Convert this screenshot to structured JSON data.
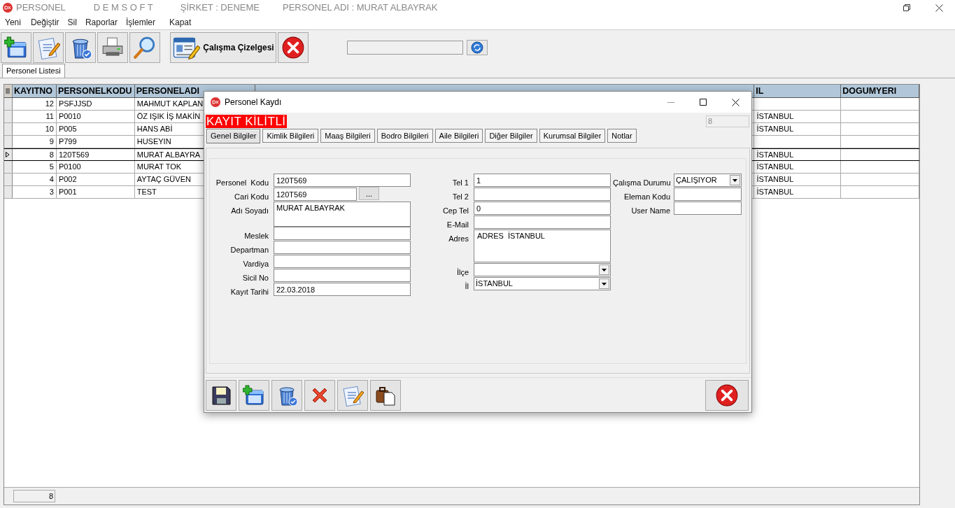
{
  "title_bar": {
    "app_name": "PERSONEL",
    "brand": "D E M S O F T",
    "company": "ŞİRKET : DENEME",
    "personnel": "PERSONEL ADI : MURAT ALBAYRAK"
  },
  "menu": [
    "Yeni",
    "Değiştir",
    "Sil",
    "Raporlar",
    "İşlemler",
    "Kapat"
  ],
  "toolbar": {
    "schedule_label": "Çalışma Çizelgesi"
  },
  "tabs": [
    {
      "label": "Personel Listesi",
      "selected": true
    }
  ],
  "grid": {
    "columns": [
      "KAYITNO",
      "PERSONELKODU",
      "PERSONELADI",
      "IL",
      "DOGUMYERI"
    ],
    "rows": [
      {
        "kayitno": "12",
        "personelkodu": "PSFJJSD",
        "personeladi": "MAHMUT KAPLAN",
        "selected": false
      },
      {
        "kayitno": "11",
        "personelkodu": "P0010",
        "personeladi": "ÖZ IŞIK İŞ MAKİN",
        "il": "İSTANBUL",
        "selected": false
      },
      {
        "kayitno": "10",
        "personelkodu": "P005",
        "personeladi": "HANS ABİ",
        "il": "İSTANBUL",
        "selected": false
      },
      {
        "kayitno": "9",
        "personelkodu": "P799",
        "personeladi": "HUSEYIN",
        "selected": false
      },
      {
        "kayitno": "8",
        "personelkodu": "120T569",
        "personeladi": "MURAT ALBAYRA",
        "il": "İSTANBUL",
        "selected": true
      },
      {
        "kayitno": "5",
        "personelkodu": "P0100",
        "personeladi": "MURAT TOK",
        "il": "İSTANBUL",
        "selected": false
      },
      {
        "kayitno": "4",
        "personelkodu": "P002",
        "personeladi": "AYTAÇ GÜVEN",
        "il": "İSTANBUL",
        "selected": false
      },
      {
        "kayitno": "3",
        "personelkodu": "P001",
        "personeladi": "TEST",
        "il": "İSTANBUL",
        "selected": false
      }
    ]
  },
  "status_bar": {
    "record_count": "8"
  },
  "dialog": {
    "title": "Personel Kaydı",
    "lock_banner": "KAYIT KİLİTLİ",
    "record_field": "8",
    "tabs": [
      {
        "label": "Genel Bilgiler",
        "selected": true
      },
      {
        "label": "Kimlik Bilgileri",
        "selected": false
      },
      {
        "label": "Maaş Bilgileri",
        "selected": false
      },
      {
        "label": "Bodro Bilgileri",
        "selected": false
      },
      {
        "label": "Aile Bilgileri",
        "selected": false
      },
      {
        "label": "Diğer Bilgiler",
        "selected": false
      },
      {
        "label": "Kurumsal Bilgiler",
        "selected": false
      },
      {
        "label": "Notlar",
        "selected": false
      }
    ],
    "form_columns": [
      [
        {
          "kind": "text",
          "label": "Personel  Kodu",
          "value": "120T569"
        },
        {
          "kind": "lookup",
          "label": "Cari Kodu",
          "value": "120T569",
          "button": "..."
        },
        {
          "kind": "memo",
          "label": "Adı Soyadı",
          "value": "MURAT ALBAYRAK"
        },
        {
          "kind": "text",
          "label": "Meslek"
        },
        {
          "kind": "text",
          "label": "Departman"
        },
        {
          "kind": "text",
          "label": "Vardiya"
        },
        {
          "kind": "text",
          "label": "Sicil No"
        },
        {
          "kind": "text",
          "label": "Kayıt Tarihi",
          "value": "22.03.2018"
        }
      ],
      [
        {
          "kind": "text",
          "label": "Tel 1",
          "value": "1"
        },
        {
          "kind": "text",
          "label": "Tel 2"
        },
        {
          "kind": "text",
          "label": "Cep Tel",
          "value": "0"
        },
        {
          "kind": "text",
          "label": "E-Mail"
        },
        {
          "kind": "address",
          "label": "Adres",
          "value": "ADRES  İSTANBUL"
        },
        {
          "kind": "combo",
          "label": "İlçe"
        },
        {
          "kind": "combo",
          "label": "İl",
          "value": "İSTANBUL"
        }
      ],
      [
        {
          "kind": "combo",
          "label": "Çalışma Durumu",
          "value": "ÇALIŞIYOR"
        },
        {
          "kind": "text",
          "label": "Eleman Kodu"
        },
        {
          "kind": "text",
          "label": "User Name"
        }
      ]
    ]
  }
}
